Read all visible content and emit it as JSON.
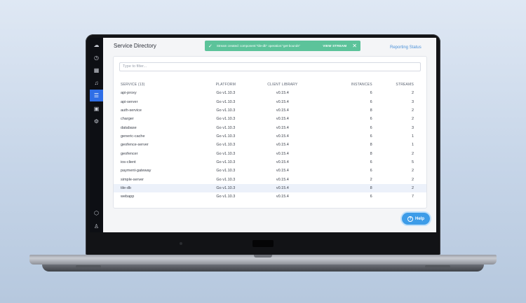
{
  "sidebar": {
    "icons": [
      {
        "name": "logo-icon",
        "glyph": "☁"
      },
      {
        "name": "clock-icon",
        "glyph": "◷"
      },
      {
        "name": "grid-icon",
        "glyph": "▦"
      },
      {
        "name": "bell-icon",
        "glyph": "♫"
      },
      {
        "name": "list-icon",
        "glyph": "☰"
      },
      {
        "name": "save-icon",
        "glyph": "▣"
      },
      {
        "name": "gear-icon",
        "glyph": "⚙"
      },
      {
        "name": "cube-icon",
        "glyph": "⬡"
      },
      {
        "name": "user-icon",
        "glyph": "♙"
      }
    ]
  },
  "header": {
    "title": "Service Directory",
    "reporting_status": "Reporting Status"
  },
  "toast": {
    "check": "✓",
    "message": "Stream created: component:\"tile-db\" operation:\"get-bounds\"",
    "action": "VIEW STREAM",
    "close": "✕"
  },
  "filter": {
    "placeholder": "Type to filter..."
  },
  "table": {
    "headers": [
      "SERVICE (13)",
      "PLATFORM",
      "CLIENT LIBRARY",
      "INSTANCES",
      "STREAMS"
    ],
    "rows": [
      [
        "api-proxy",
        "Go v1.10.3",
        "v0.15.4",
        "6",
        "2"
      ],
      [
        "api-server",
        "Go v1.10.3",
        "v0.15.4",
        "6",
        "3"
      ],
      [
        "auth-service",
        "Go v1.10.3",
        "v0.15.4",
        "8",
        "2"
      ],
      [
        "charger",
        "Go v1.10.3",
        "v0.15.4",
        "6",
        "2"
      ],
      [
        "database",
        "Go v1.10.3",
        "v0.15.4",
        "6",
        "3"
      ],
      [
        "generic-cache",
        "Go v1.10.3",
        "v0.15.4",
        "6",
        "1"
      ],
      [
        "geofence-server",
        "Go v1.10.3",
        "v0.15.4",
        "8",
        "1"
      ],
      [
        "geofencer",
        "Go v1.10.3",
        "v0.15.4",
        "8",
        "2"
      ],
      [
        "ios-client",
        "Go v1.10.3",
        "v0.15.4",
        "6",
        "5"
      ],
      [
        "payment-gateway",
        "Go v1.10.3",
        "v0.15.4",
        "6",
        "2"
      ],
      [
        "simple-server",
        "Go v1.10.3",
        "v0.15.4",
        "2",
        "2"
      ],
      [
        "tile-db",
        "Go v1.10.3",
        "v0.15.4",
        "8",
        "2"
      ],
      [
        "webapp",
        "Go v1.10.3",
        "v0.15.4",
        "6",
        "7"
      ]
    ],
    "selected_row": 11
  },
  "help": {
    "label": "Help",
    "glyph": "?"
  },
  "colors": {
    "accent": "#2f6ee6",
    "toast": "#5cc39a",
    "link": "#4a90d8",
    "help": "#3d9ce8"
  }
}
